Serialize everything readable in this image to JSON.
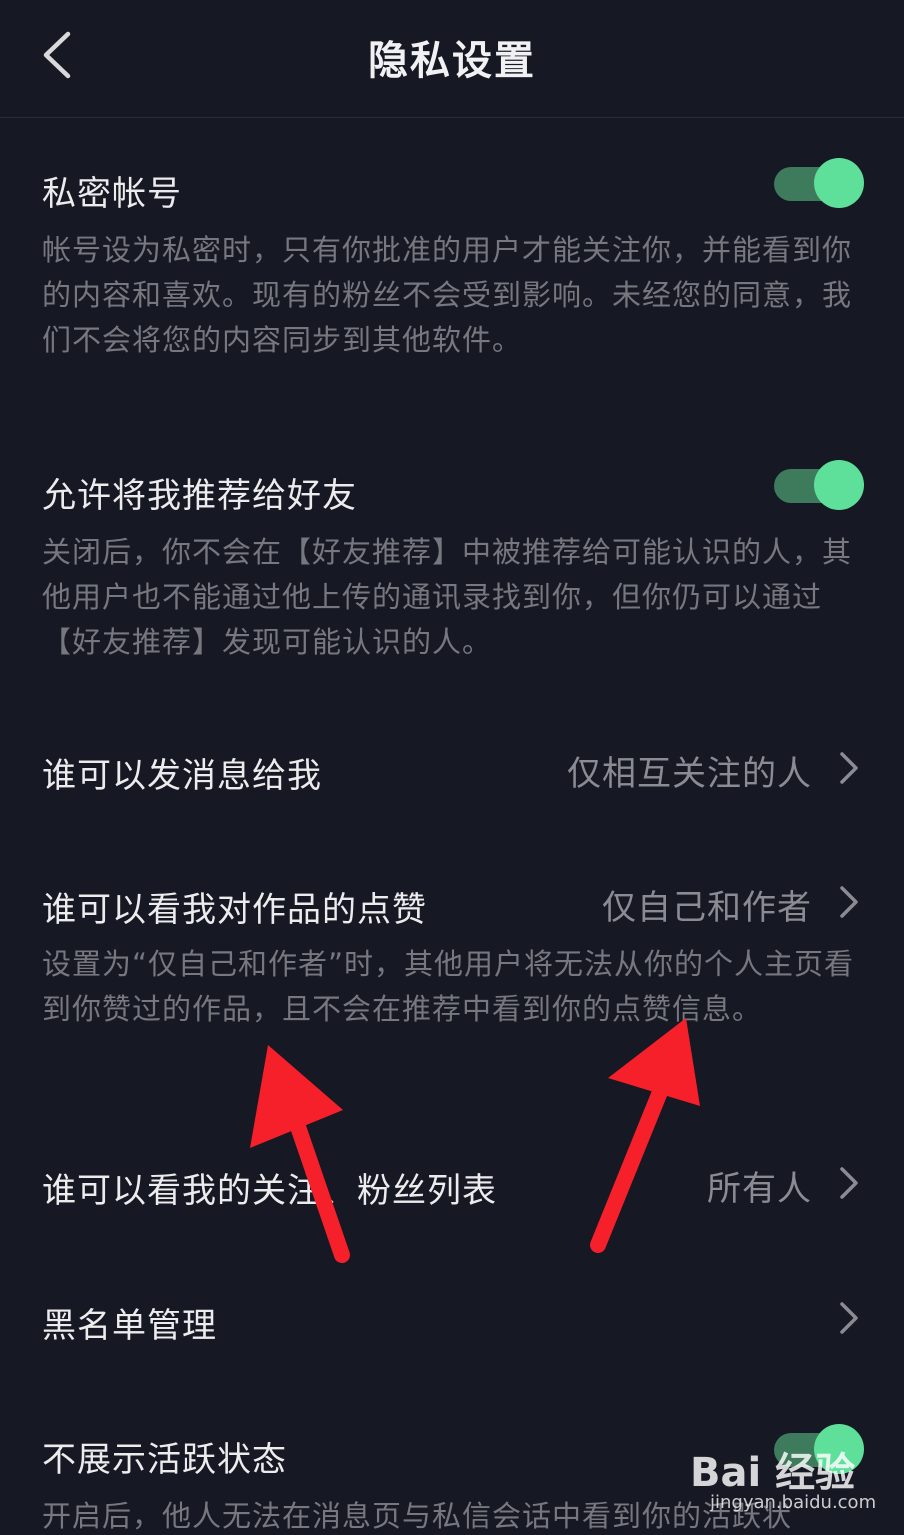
{
  "header": {
    "title": "隐私设置",
    "back_icon": "chevron-left-icon"
  },
  "settings": {
    "private_account": {
      "title": "私密帐号",
      "desc": "帐号设为私密时，只有你批准的用户才能关注你，并能看到你的内容和喜欢。现有的粉丝不会受到影响。未经您的同意，我们不会将您的内容同步到其他软件。",
      "enabled": true
    },
    "recommend_to_friends": {
      "title": "允许将我推荐给好友",
      "desc": "关闭后，你不会在【好友推荐】中被推荐给可能认识的人，其他用户也不能通过他上传的通讯录找到你，但你仍可以通过【好友推荐】发现可能认识的人。",
      "enabled": true
    },
    "who_can_message": {
      "title": "谁可以发消息给我",
      "value": "仅相互关注的人"
    },
    "who_can_see_likes": {
      "title": "谁可以看我对作品的点赞",
      "value": "仅自己和作者",
      "desc": "设置为“仅自己和作者”时，其他用户将无法从你的个人主页看到你赞过的作品，且不会在推荐中看到你的点赞信息。"
    },
    "who_can_see_follow_list": {
      "title": "谁可以看我的关注、粉丝列表",
      "value": "所有人"
    },
    "blacklist": {
      "title": "黑名单管理"
    },
    "hide_activity": {
      "title": "不展示活跃状态",
      "desc": "开启后，他人无法在消息页与私信会话中看到你的活跃状",
      "enabled": true
    }
  },
  "watermark": {
    "logo": "Bai 经验",
    "url": "jingyan.baidu.com"
  },
  "colors": {
    "background": "#161823",
    "toggle_on": "#5ee09a",
    "annotation_arrow": "#f5202a"
  }
}
